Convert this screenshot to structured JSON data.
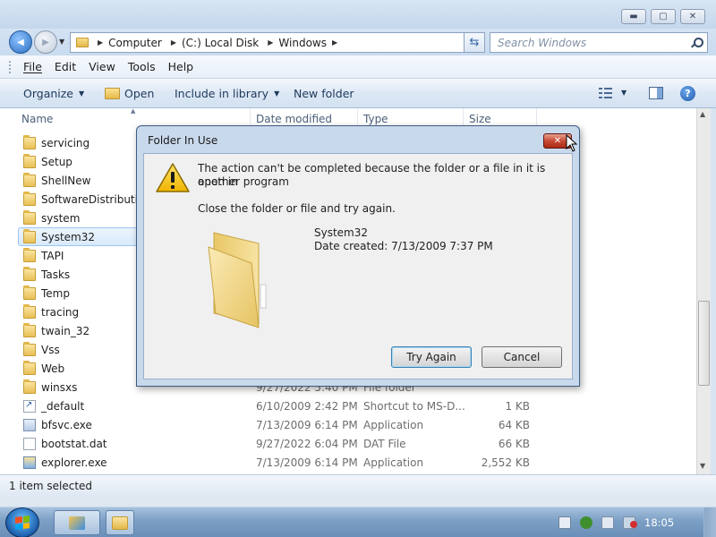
{
  "window": {
    "caption_min": "▬",
    "caption_max": "▢",
    "caption_close": "✕"
  },
  "nav": {
    "back_glyph": "◀",
    "fwd_glyph": "▶",
    "refresh_glyph": "⇆",
    "breadcrumbs": [
      "Computer",
      "(C:) Local Disk",
      "Windows"
    ],
    "search_placeholder": "Search Windows"
  },
  "menu": [
    "File",
    "Edit",
    "View",
    "Tools",
    "Help"
  ],
  "toolbar": {
    "organize": "Organize",
    "open": "Open",
    "include_in_library": "Include in library",
    "new_folder": "New folder",
    "help": "?"
  },
  "columns": {
    "name": "Name",
    "date_modified": "Date modified",
    "type": "Type",
    "size": "Size"
  },
  "folders": [
    {
      "name": "servicing"
    },
    {
      "name": "Setup"
    },
    {
      "name": "ShellNew"
    },
    {
      "name": "SoftwareDistribution"
    },
    {
      "name": "system"
    },
    {
      "name": "System32",
      "selected": true
    },
    {
      "name": "TAPI"
    },
    {
      "name": "Tasks"
    },
    {
      "name": "Temp"
    },
    {
      "name": "tracing"
    },
    {
      "name": "twain_32"
    },
    {
      "name": "Vss"
    },
    {
      "name": "Web"
    },
    {
      "name": "winsxs",
      "date": "9/27/2022 5:40 PM",
      "type": "File folder",
      "size": ""
    }
  ],
  "files": [
    {
      "name": "_default",
      "date": "6/10/2009 2:42 PM",
      "type": "Shortcut to MS-D...",
      "size": "1 KB",
      "icon": "shortcut"
    },
    {
      "name": "bfsvc.exe",
      "date": "7/13/2009 6:14 PM",
      "type": "Application",
      "size": "64 KB",
      "icon": "exe"
    },
    {
      "name": "bootstat.dat",
      "date": "9/27/2022 6:04 PM",
      "type": "DAT File",
      "size": "66 KB",
      "icon": "dat"
    },
    {
      "name": "explorer.exe",
      "date": "7/13/2009 6:14 PM",
      "type": "Application",
      "size": "2,552 KB",
      "icon": "exp"
    }
  ],
  "status": "1 item selected",
  "dialog": {
    "title": "Folder In Use",
    "close_glyph": "✕",
    "message_line1": "The action can't be completed because the folder or a file in it is open in",
    "message_line2": "another program",
    "instruction": "Close the folder or file and try again.",
    "item_name": "System32",
    "item_date": "Date created: 7/13/2009 7:37 PM",
    "try_again": "Try Again",
    "cancel": "Cancel"
  },
  "taskbar": {
    "clock": "18:05"
  }
}
